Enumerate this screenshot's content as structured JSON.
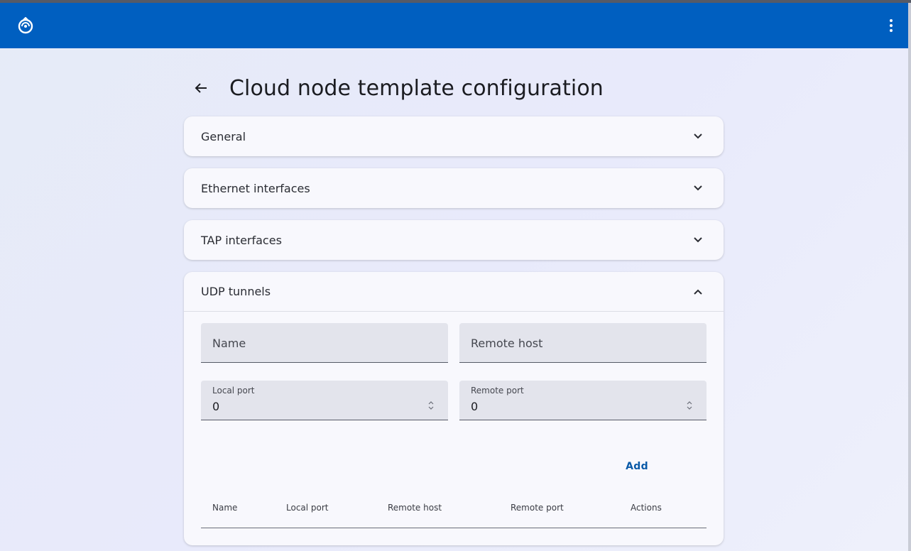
{
  "appbar": {
    "logo_icon": "gns3-logo-icon",
    "menu_icon": "more-vert-icon",
    "color": "#005fc0"
  },
  "page": {
    "title": "Cloud node template configuration",
    "back_icon": "arrow-back-icon"
  },
  "panels": [
    {
      "title": "General",
      "expanded": false
    },
    {
      "title": "Ethernet interfaces",
      "expanded": false
    },
    {
      "title": "TAP interfaces",
      "expanded": false
    },
    {
      "title": "UDP tunnels",
      "expanded": true
    }
  ],
  "udp": {
    "name_placeholder": "Name",
    "remote_host_placeholder": "Remote host",
    "local_port_label": "Local port",
    "local_port_value": "0",
    "remote_port_label": "Remote port",
    "remote_port_value": "0",
    "add_label": "Add",
    "accent": "#0a5aa8",
    "table_headers": [
      "Name",
      "Local port",
      "Remote host",
      "Remote port",
      "Actions"
    ]
  }
}
